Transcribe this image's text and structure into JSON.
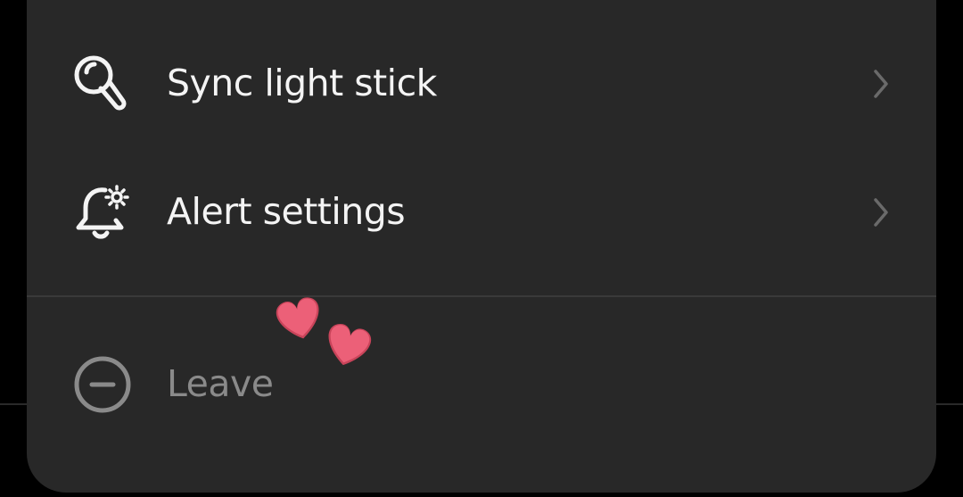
{
  "menu": {
    "items": [
      {
        "label": "Sync light stick",
        "icon": "light-stick-icon",
        "has_chevron": true
      },
      {
        "label": "Alert settings",
        "icon": "bell-settings-icon",
        "has_chevron": true
      }
    ],
    "leave": {
      "label": "Leave",
      "icon": "minus-circle-icon"
    }
  },
  "colors": {
    "background": "#000000",
    "sheet": "#282828",
    "text": "#f4f4f4",
    "muted_text": "#8a8a8a",
    "chevron": "#6a6a6a",
    "heart": "#e85a6e"
  },
  "decorations": [
    "hearts-sticker-icon"
  ]
}
